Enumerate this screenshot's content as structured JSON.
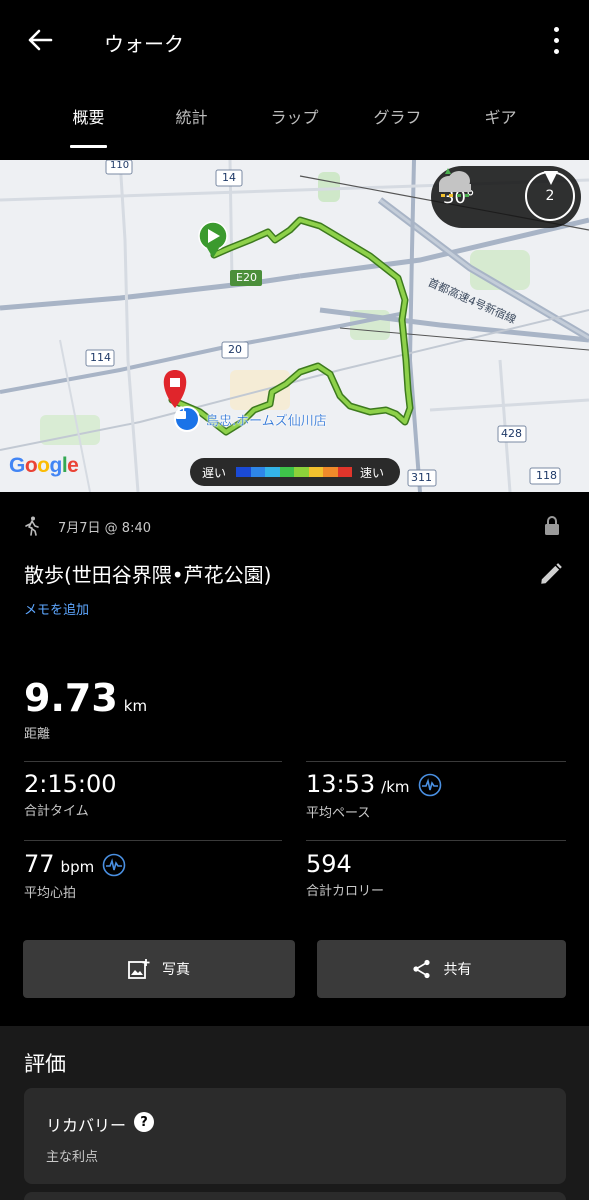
{
  "header": {
    "title": "ウォーク"
  },
  "tabs": [
    {
      "label": "概要",
      "active": true
    },
    {
      "label": "統計"
    },
    {
      "label": "ラップ"
    },
    {
      "label": "グラフ"
    },
    {
      "label": "ギア"
    }
  ],
  "map": {
    "weather": {
      "temperature": "30°",
      "wind_speed": "2",
      "icon": "cloud-rain-icon"
    },
    "legend": {
      "slow": "遅い",
      "fast": "速い",
      "colors": [
        "#1a4ad6",
        "#2e86e8",
        "#34b4e8",
        "#3ec34a",
        "#8cd23a",
        "#f2c12e",
        "#f08a2a",
        "#e0352b"
      ]
    },
    "poi_label": "島忠.ホームズ仙川店",
    "road_labels": [
      "110",
      "14",
      "E20",
      "20",
      "114",
      "首都高速4号新宿線",
      "428",
      "311",
      "118"
    ],
    "google": "Google"
  },
  "activity": {
    "date": "7月7日 @ 8:40",
    "name": "散歩(世田谷界隈•芦花公園)",
    "add_memo": "メモを追加"
  },
  "stats": {
    "distance": {
      "value": "9.73",
      "unit": "km",
      "label": "距離"
    },
    "total_time": {
      "value": "2:15:00",
      "label": "合計タイム"
    },
    "avg_pace": {
      "value": "13:53",
      "unit": "/km",
      "label": "平均ペース"
    },
    "avg_hr": {
      "value": "77",
      "unit": "bpm",
      "label": "平均心拍"
    },
    "calories": {
      "value": "594",
      "label": "合計カロリー"
    }
  },
  "actions": {
    "photo": "写真",
    "share": "共有"
  },
  "evaluation": {
    "title": "評価",
    "card": {
      "name": "リカバリー",
      "help": "?",
      "sub": "主な利点"
    }
  }
}
